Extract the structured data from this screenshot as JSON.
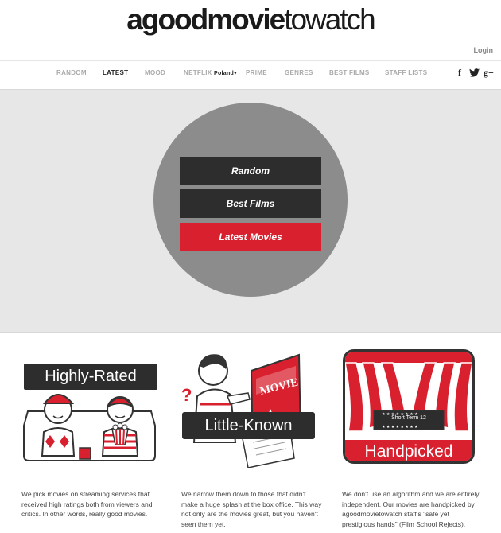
{
  "header": {
    "logo_bold": "agoodmovie",
    "logo_light": "towatch",
    "login": "Login"
  },
  "nav": {
    "items": [
      "RANDOM",
      "LATEST",
      "MOOD",
      "NETFLIX",
      "PRIME",
      "GENRES",
      "BEST FILMS",
      "STAFF LISTS"
    ],
    "active": "LATEST",
    "country": "Poland"
  },
  "social": [
    "facebook-icon",
    "twitter-icon",
    "google-plus-icon"
  ],
  "hero": {
    "buttons": [
      "Random",
      "Best Films",
      "Latest Movies"
    ]
  },
  "features": [
    {
      "label": "Highly-Rated",
      "text": "We pick movies on streaming services that received high ratings both from viewers and critics. In other words, really good movies."
    },
    {
      "label": "Little-Known",
      "text": "We narrow them down to those that didn't make a huge splash at the box office. This way not only are the movies great, but you haven't seen them yet."
    },
    {
      "label": "Handpicked",
      "sign": "Short Term 12",
      "text": "We don't use an algorithm and we are entirely independent. Our movies are handpicked by agoodmovietowatch staff's \"safe yet prestigious hands\" (Film School Rejects)."
    }
  ],
  "colors": {
    "accent": "#d9202f",
    "dark": "#2d2d2d",
    "hero_bg": "#e7e7e7",
    "circle": "#8c8c8c"
  }
}
